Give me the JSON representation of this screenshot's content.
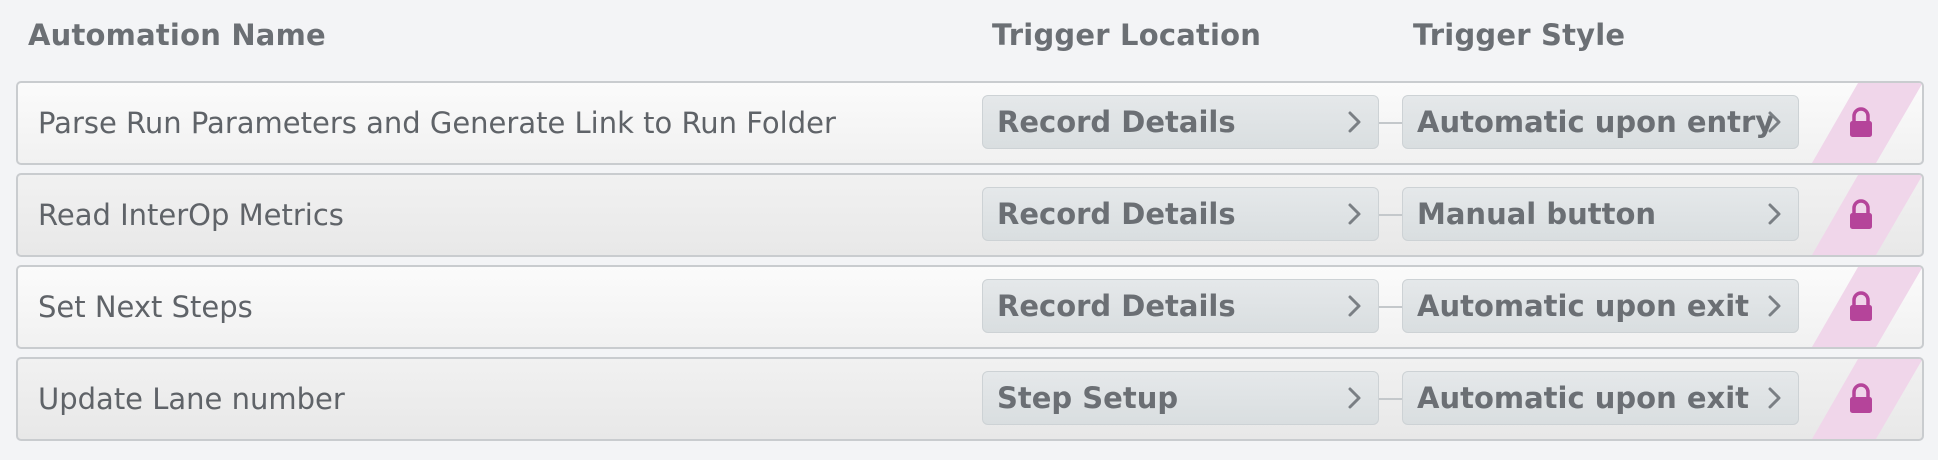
{
  "header": {
    "name_label": "Automation Name",
    "location_label": "Trigger Location",
    "style_label": "Trigger Style"
  },
  "rows": [
    {
      "name": "Parse Run Parameters and Generate Link to Run Folder",
      "trigger_location": "Record Details",
      "trigger_style": "Automatic upon entry",
      "locked": true
    },
    {
      "name": "Read InterOp Metrics",
      "trigger_location": "Record Details",
      "trigger_style": "Manual button",
      "locked": true
    },
    {
      "name": "Set Next Steps",
      "trigger_location": "Record Details",
      "trigger_style": "Automatic upon exit",
      "locked": true
    },
    {
      "name": "Update Lane number",
      "trigger_location": "Step Setup",
      "trigger_style": "Automatic upon exit",
      "locked": true
    }
  ],
  "icons": {
    "lock": "lock-icon",
    "chevron": "chevron-right-icon"
  },
  "colors": {
    "lock": "#b5449a",
    "lock_band": "#f0d6ea",
    "pill_bg": "#dfe3e5",
    "text": "#5f6368"
  }
}
